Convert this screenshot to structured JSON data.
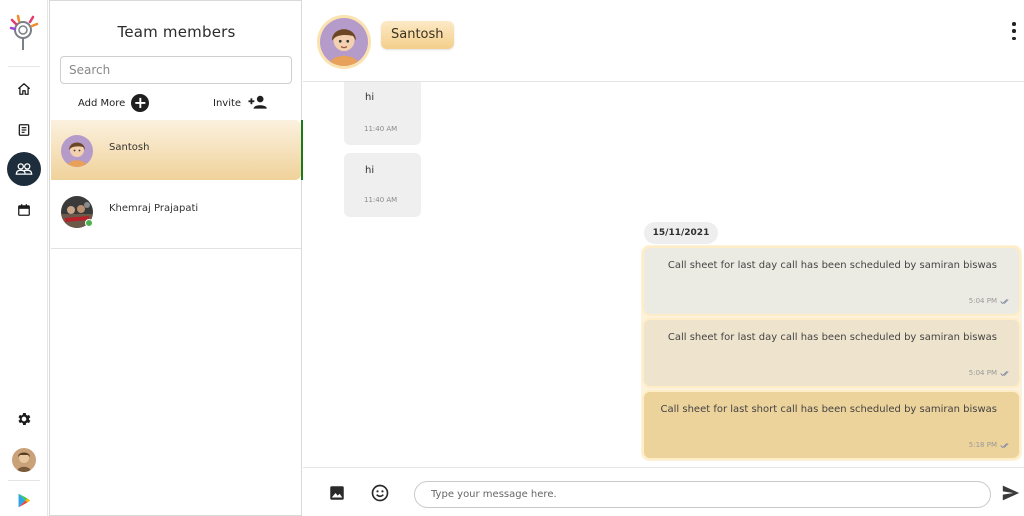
{
  "rail": {
    "nav": [
      "home-icon",
      "document-icon",
      "team-icon",
      "calendar-icon"
    ],
    "active": "team-icon",
    "bottom": [
      "gear-icon",
      "avatar",
      "play-store-icon"
    ]
  },
  "panel": {
    "title": "Team members",
    "search_placeholder": "Search",
    "add_more_label": "Add More",
    "invite_label": "Invite",
    "members": [
      {
        "name": "Santosh",
        "selected": true,
        "online": false
      },
      {
        "name": "Khemraj Prajapati",
        "selected": false,
        "online": true
      }
    ]
  },
  "chat": {
    "contact_name": "Santosh",
    "incoming": [
      {
        "text": "hi",
        "time": "11:40 AM"
      },
      {
        "text": "hi",
        "time": "11:40 AM"
      }
    ],
    "date_separator": "15/11/2021",
    "outgoing": [
      {
        "text": "Call sheet for last day call has been scheduled by samiran biswas",
        "time": "5:04 PM"
      },
      {
        "text": "Call sheet for last day call has been scheduled by samiran biswas",
        "time": "5:04 PM"
      },
      {
        "text": "Call sheet for last short call has been scheduled by samiran biswas",
        "time": "5:18 PM"
      }
    ],
    "composer_placeholder": "Type your message here."
  },
  "colors": {
    "accent_dark": "#1e2d3b",
    "selected_bar": "#1a7a1a",
    "gold": "#f0d29a",
    "online": "#4caf50"
  }
}
